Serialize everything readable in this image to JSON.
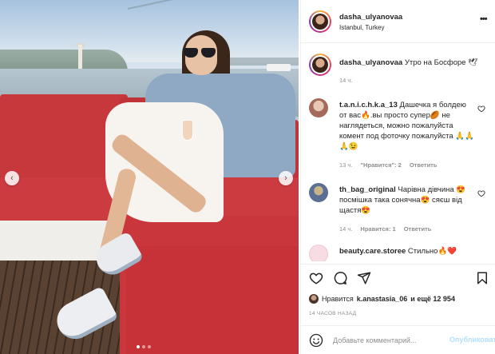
{
  "post": {
    "username": "dasha_ulyanovaa",
    "location": "Istanbul, Turkey",
    "more_label": "•••",
    "caption": {
      "username": "dasha_ulyanovaa",
      "text": "Утро на Босфоре 🕊",
      "time": "14 ч."
    },
    "photo": {
      "nav_left": "‹",
      "nav_right": "›",
      "slides": 3,
      "active_slide": 1
    }
  },
  "comments": [
    {
      "username": "t.a.n.i.c.h.k.a_13",
      "text": "Дашечка я болдею от вас🔥.вы просто супер🏉 не наглядеться, можно пожалуйста комент под фоточку пожалуйста 🙏🙏🙏😉",
      "time": "13 ч.",
      "likes": "\"Нравится\": 2",
      "reply": "Ответить"
    },
    {
      "username": "th_bag_original",
      "text": "Чарівна дівчина 😍 посмішка така сонячна😍 сяєш від щастя😍",
      "time": "14 ч.",
      "likes": "Нравится: 1",
      "reply": "Ответить"
    },
    {
      "username": "beauty.care.storee",
      "text": "Стильно🔥❤️",
      "time": "",
      "likes": "",
      "reply": ""
    }
  ],
  "likes": {
    "prefix": "Нравится",
    "user": "k.anastasia_06",
    "suffix": "и ещё 12 954"
  },
  "time_ago": "14 ЧАСОВ НАЗАД",
  "add_comment": {
    "placeholder": "Добавьте комментарий...",
    "publish_label": "Опубликовать"
  },
  "colors": {
    "accent": "#0095f6",
    "publish_disabled": "#b2dffc",
    "muted": "#8e8e8e",
    "text": "#262626"
  }
}
